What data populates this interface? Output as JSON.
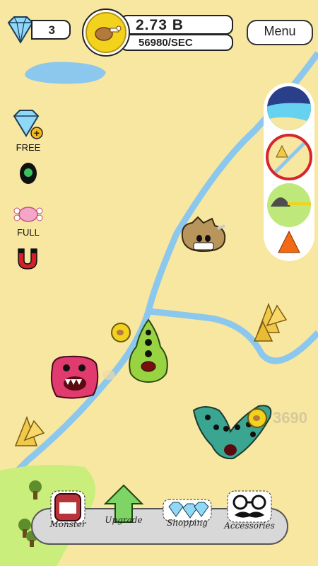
{
  "hud": {
    "gems": "3",
    "coins_total": "2.73 B",
    "coins_rate": "56980/SEC",
    "menu_label": "Menu"
  },
  "side_menu": {
    "free_label": "FREE",
    "food_label": "FULL"
  },
  "map": {
    "floating_value": "3690"
  },
  "bottom_tabs": [
    {
      "label": "Monster"
    },
    {
      "label": "Upgrade"
    },
    {
      "label": "Shopping"
    },
    {
      "label": "Accessories"
    }
  ],
  "colors": {
    "sand": "#f8e7a0",
    "river": "#8cc7ee",
    "grass": "#c9ee7c",
    "coin": "#f3d21d"
  }
}
